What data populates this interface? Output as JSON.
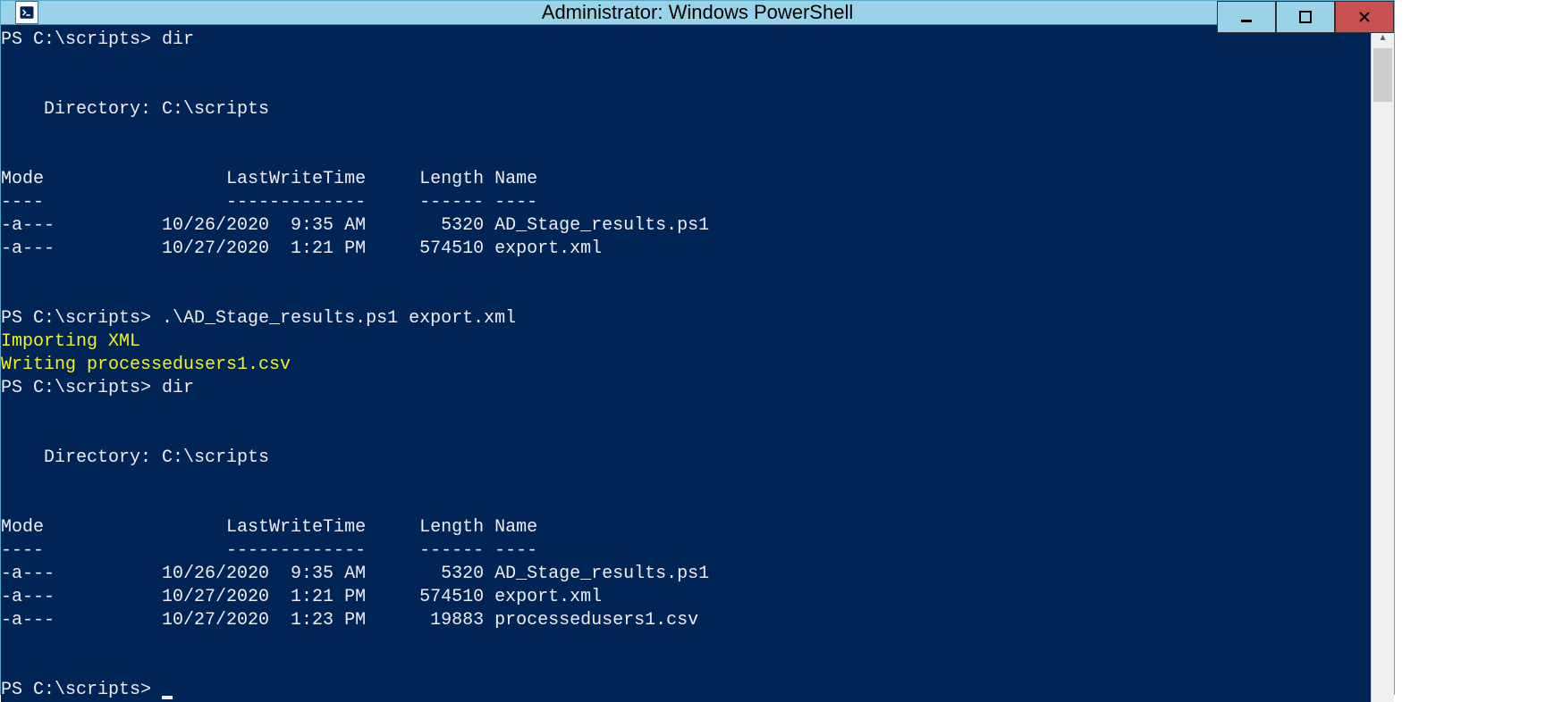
{
  "window": {
    "title": "Administrator: Windows PowerShell"
  },
  "terminal": {
    "prompt": "PS C:\\scripts>",
    "cmd_dir": "dir",
    "cmd_script": ".\\AD_Stage_results.ps1 export.xml",
    "directory_label": "    Directory: C:\\scripts",
    "header": {
      "mode": "Mode",
      "lastwrite": "LastWriteTime",
      "length": "Length",
      "name": "Name"
    },
    "divider": {
      "mode": "----",
      "lastwrite": "-------------",
      "length": "------",
      "name": "----"
    },
    "listing1": [
      {
        "mode": "-a---",
        "date": "10/26/2020",
        "time": "9:35 AM",
        "length": "5320",
        "name": "AD_Stage_results.ps1"
      },
      {
        "mode": "-a---",
        "date": "10/27/2020",
        "time": "1:21 PM",
        "length": "574510",
        "name": "export.xml"
      }
    ],
    "script_output": [
      "Importing XML",
      "Writing processedusers1.csv"
    ],
    "listing2": [
      {
        "mode": "-a---",
        "date": "10/26/2020",
        "time": "9:35 AM",
        "length": "5320",
        "name": "AD_Stage_results.ps1"
      },
      {
        "mode": "-a---",
        "date": "10/27/2020",
        "time": "1:21 PM",
        "length": "574510",
        "name": "export.xml"
      },
      {
        "mode": "-a---",
        "date": "10/27/2020",
        "time": "1:23 PM",
        "length": "19883",
        "name": "processedusers1.csv"
      }
    ]
  }
}
